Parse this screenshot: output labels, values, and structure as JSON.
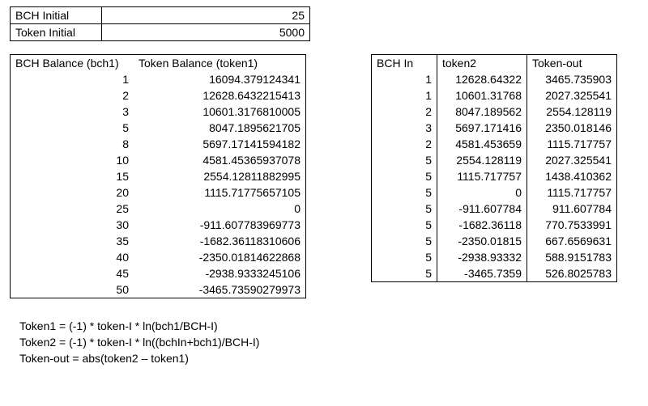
{
  "init": {
    "bch_label": "BCH Initial",
    "bch_value": "25",
    "token_label": "Token Initial",
    "token_value": "5000"
  },
  "balance": {
    "header1": "BCH Balance (bch1)",
    "header2": "Token Balance (token1)",
    "rows": [
      {
        "bch": "1",
        "tok": "16094.379124341"
      },
      {
        "bch": "2",
        "tok": "12628.6432215413"
      },
      {
        "bch": "3",
        "tok": "10601.3176810005"
      },
      {
        "bch": "5",
        "tok": "8047.1895621705"
      },
      {
        "bch": "8",
        "tok": "5697.17141594182"
      },
      {
        "bch": "10",
        "tok": "4581.45365937078"
      },
      {
        "bch": "15",
        "tok": "2554.12811882995"
      },
      {
        "bch": "20",
        "tok": "1115.71775657105"
      },
      {
        "bch": "25",
        "tok": "0"
      },
      {
        "bch": "30",
        "tok": "-911.607783969773"
      },
      {
        "bch": "35",
        "tok": "-1682.36118310606"
      },
      {
        "bch": "40",
        "tok": "-2350.01814622868"
      },
      {
        "bch": "45",
        "tok": "-2938.9333245106"
      },
      {
        "bch": "50",
        "tok": "-3465.73590279973"
      }
    ]
  },
  "delta": {
    "header1": "BCH In",
    "header2": "token2",
    "header3": "Token-out",
    "rows": [
      {
        "in": "1",
        "t2": "12628.64322",
        "out": "3465.735903"
      },
      {
        "in": "1",
        "t2": "10601.31768",
        "out": "2027.325541"
      },
      {
        "in": "2",
        "t2": "8047.189562",
        "out": "2554.128119"
      },
      {
        "in": "3",
        "t2": "5697.171416",
        "out": "2350.018146"
      },
      {
        "in": "2",
        "t2": "4581.453659",
        "out": "1115.717757"
      },
      {
        "in": "5",
        "t2": "2554.128119",
        "out": "2027.325541"
      },
      {
        "in": "5",
        "t2": "1115.717757",
        "out": "1438.410362"
      },
      {
        "in": "5",
        "t2": "0",
        "out": "1115.717757"
      },
      {
        "in": "5",
        "t2": "-911.607784",
        "out": "911.607784"
      },
      {
        "in": "5",
        "t2": "-1682.36118",
        "out": "770.7533991"
      },
      {
        "in": "5",
        "t2": "-2350.01815",
        "out": "667.6569631"
      },
      {
        "in": "5",
        "t2": "-2938.93332",
        "out": "588.9151783"
      },
      {
        "in": "5",
        "t2": "-3465.7359",
        "out": "526.8025783"
      }
    ]
  },
  "formulas": {
    "f1": "Token1 = (-1) * token-I * ln(bch1/BCH-I)",
    "f2": "Token2 = (-1) * token-I * ln((bchIn+bch1)/BCH-I)",
    "f3": "Token-out = abs(token2 – token1)"
  }
}
